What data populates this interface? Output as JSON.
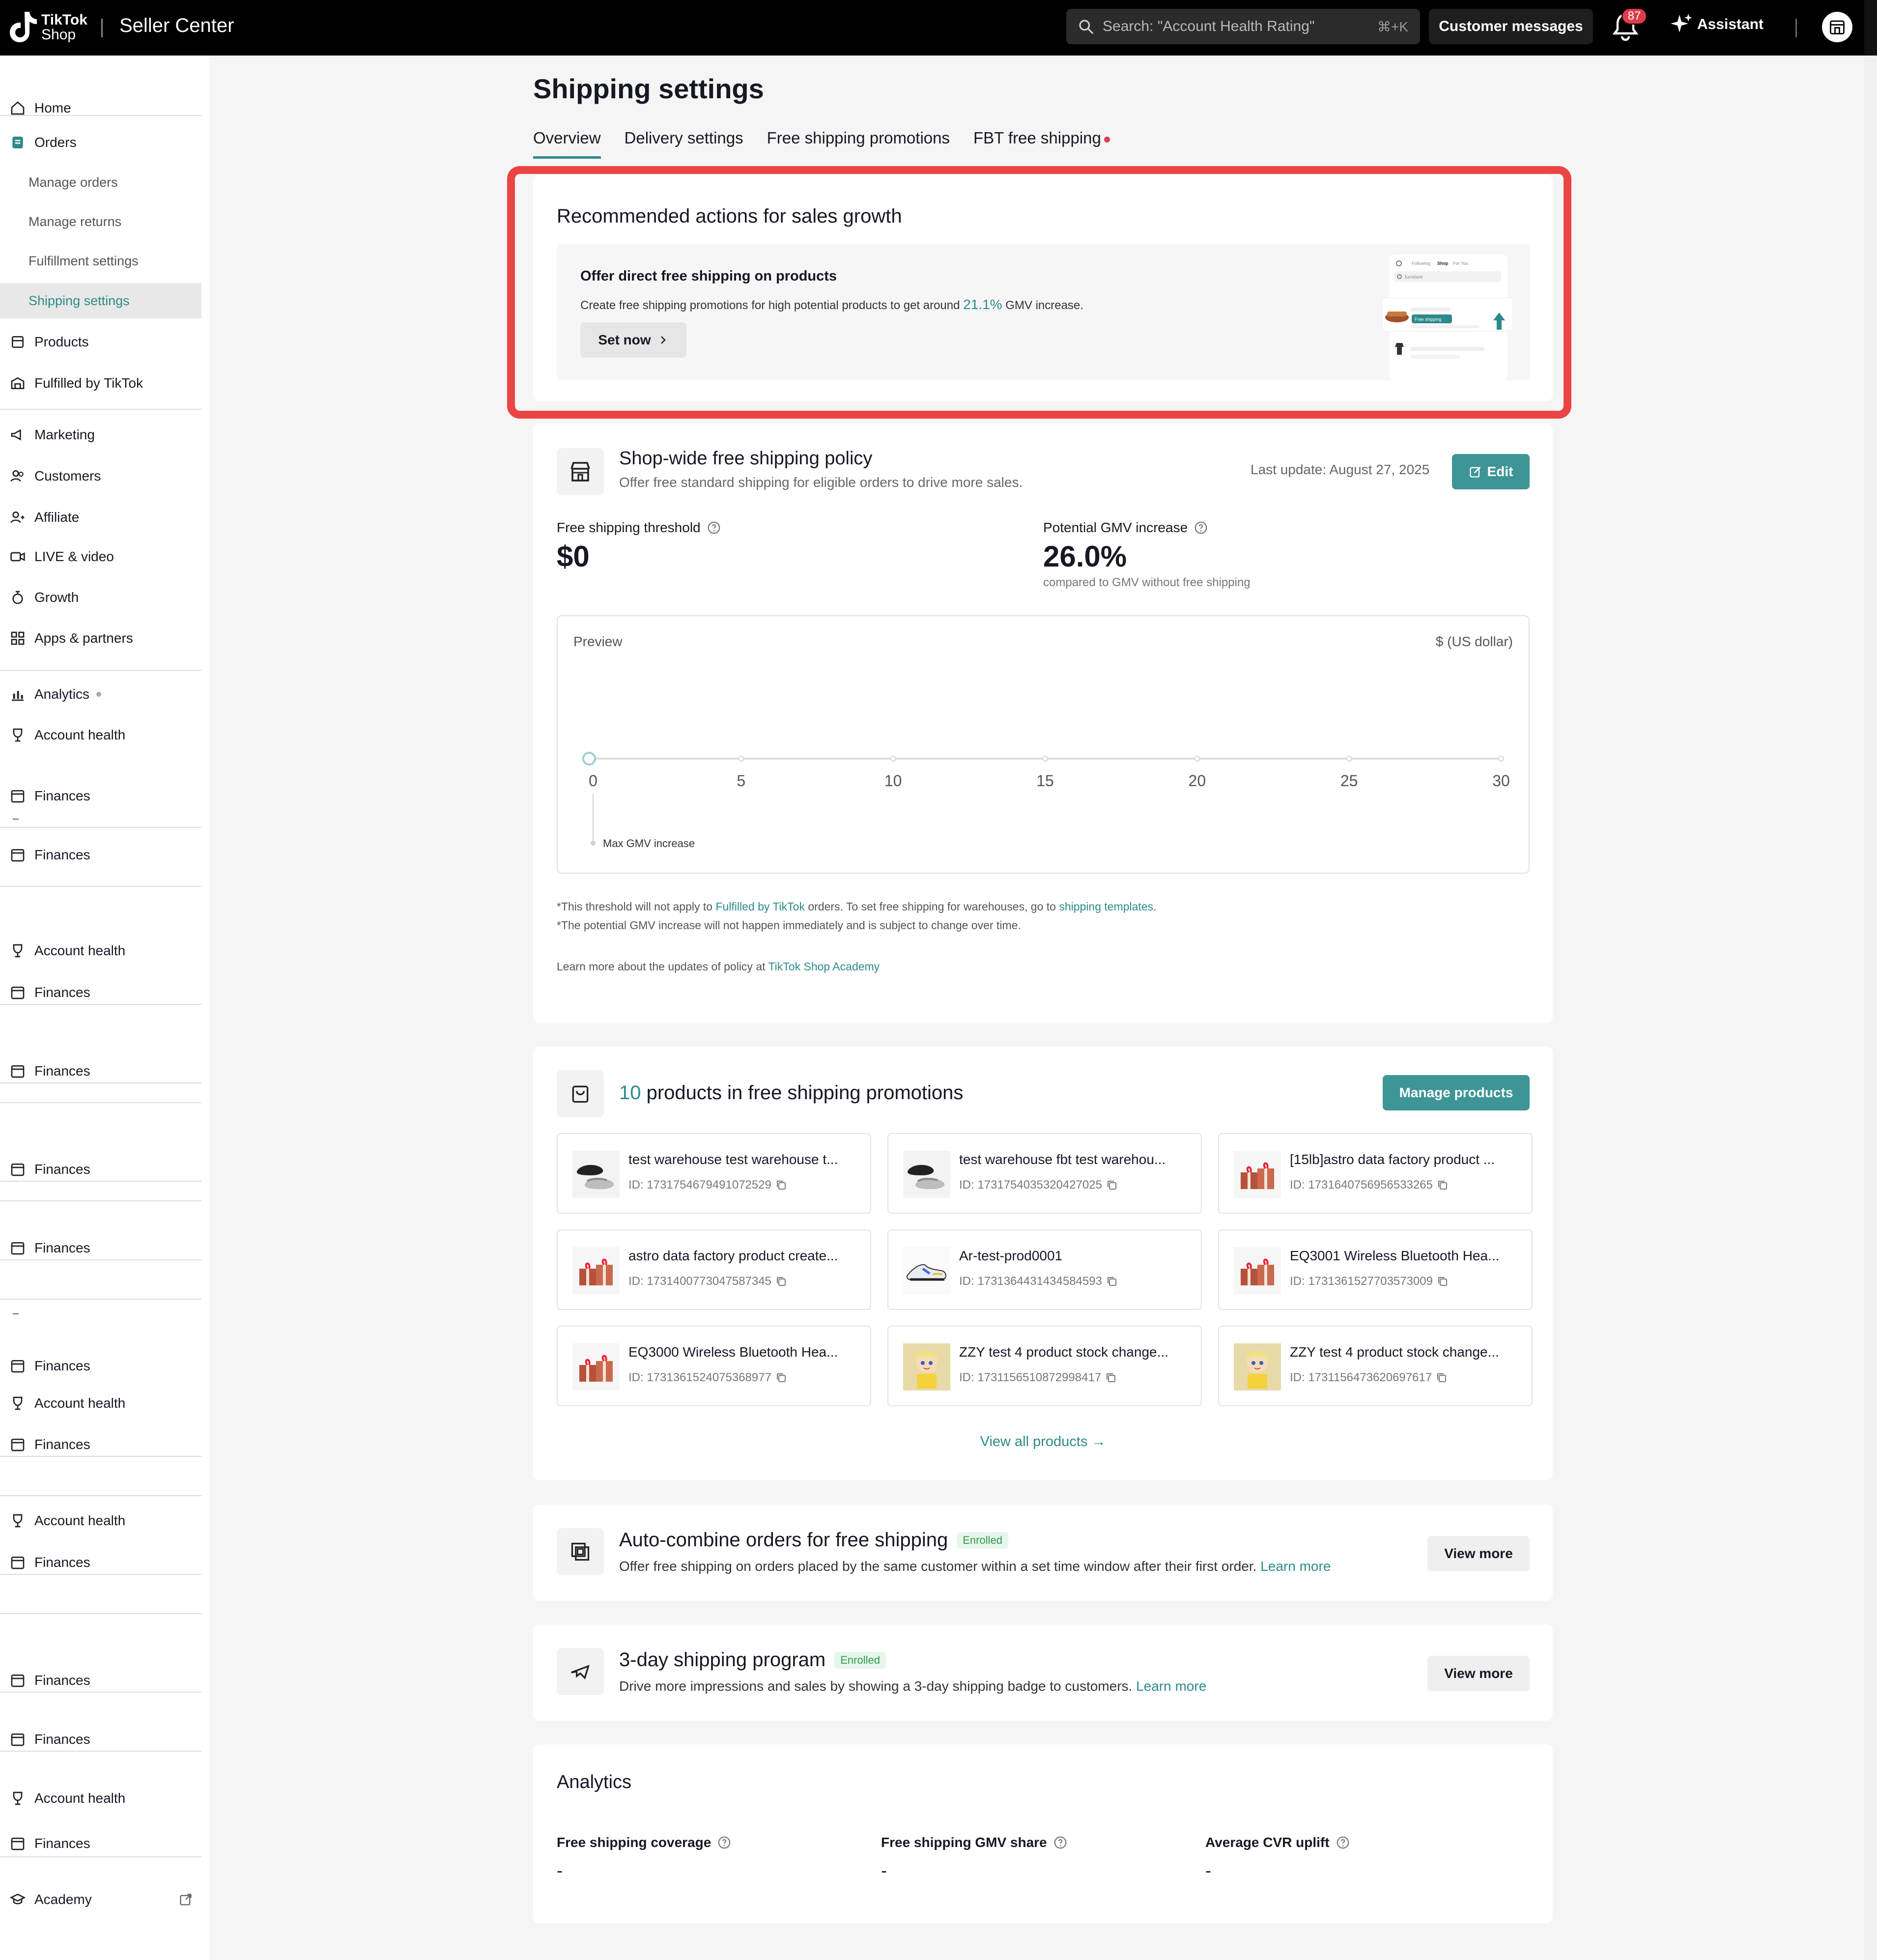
{
  "header": {
    "brand_line1": "TikTok",
    "brand_line2": "Shop",
    "app_name": "Seller Center",
    "search_placeholder": "Search: \"Account Health Rating\"",
    "search_shortcut": "⌘+K",
    "customer_messages": "Customer messages",
    "notification_count": "87",
    "assistant": "Assistant"
  },
  "sidebar": {
    "home": "Home",
    "orders": "Orders",
    "manage_orders": "Manage orders",
    "manage_returns": "Manage returns",
    "fulfillment_settings": "Fulfillment settings",
    "shipping_settings": "Shipping settings",
    "products": "Products",
    "fulfilled_by_tiktok": "Fulfilled by TikTok",
    "marketing": "Marketing",
    "customers": "Customers",
    "affiliate": "Affiliate",
    "live_video": "LIVE & video",
    "growth": "Growth",
    "apps_partners": "Apps & partners",
    "analytics": "Analytics",
    "account_health": "Account health",
    "finances": "Finances",
    "academy": "Academy"
  },
  "page": {
    "title": "Shipping settings",
    "tabs": [
      "Overview",
      "Delivery settings",
      "Free shipping promotions",
      "FBT free shipping"
    ]
  },
  "recommended": {
    "title": "Recommended actions for sales growth",
    "offer_title": "Offer direct free shipping on products",
    "offer_desc_pre": "Create free shipping promotions for high potential products to get around ",
    "offer_desc_value": "21.1%",
    "offer_desc_post": " GMV increase.",
    "set_now": "Set now",
    "illus_tabs": [
      "Following",
      "Shop",
      "For You"
    ],
    "illus_search": "furniture",
    "illus_tag": "Free shipping"
  },
  "shopwide": {
    "title": "Shop-wide free shipping policy",
    "subtitle": "Offer free standard shipping for eligible orders to drive more sales.",
    "last_update": "Last update: August 27, 2025",
    "edit": "Edit",
    "threshold_label": "Free shipping threshold",
    "threshold_value": "$0",
    "gmv_label": "Potential GMV increase",
    "gmv_value": "26.0%",
    "gmv_compare": "compared to GMV without free shipping",
    "preview_label": "Preview",
    "preview_unit": "$ (US dollar)",
    "note1_pre": "*This threshold will not apply to ",
    "note1_link1": "Fulfilled by TikTok",
    "note1_mid": " orders. To set free shipping for warehouses, go to ",
    "note1_link2": "shipping templates",
    "note1_post": ".",
    "note2": "*The potential GMV increase will not happen immediately and is subject to change over time.",
    "note3_pre": "Learn more about the updates of policy at ",
    "note3_link": "TikTok Shop Academy"
  },
  "chart_data": {
    "type": "line",
    "x": [
      0,
      5,
      10,
      15,
      20,
      25,
      30
    ],
    "tick_labels": [
      "0",
      "5",
      "10",
      "15",
      "20",
      "25",
      "30"
    ],
    "xlim": [
      0,
      30
    ],
    "selected_value": 0,
    "annotation": "Max GMV increase",
    "unit": "$ (US dollar)"
  },
  "promo_products": {
    "count": "10",
    "title_rest": " products in free shipping promotions",
    "manage": "Manage products",
    "items": [
      {
        "name": "test warehouse test warehouse t...",
        "id": "ID: 1731754679491072529",
        "thumb": "sandals"
      },
      {
        "name": "test warehouse fbt test warehou...",
        "id": "ID: 1731754035320427025",
        "thumb": "sandals"
      },
      {
        "name": "[15lb]astro data factory product ...",
        "id": "ID: 1731640756956533265",
        "thumb": "gift"
      },
      {
        "name": "astro data factory product create...",
        "id": "ID: 1731400773047587345",
        "thumb": "gift"
      },
      {
        "name": "Ar-test-prod0001",
        "id": "ID: 1731364431434584593",
        "thumb": "sneaker"
      },
      {
        "name": "EQ3001 Wireless Bluetooth Hea...",
        "id": "ID: 1731361527703573009",
        "thumb": "gift"
      },
      {
        "name": "EQ3000 Wireless Bluetooth Hea...",
        "id": "ID: 1731361524075368977",
        "thumb": "gift"
      },
      {
        "name": "ZZY test 4 product stock change...",
        "id": "ID: 1731156510872998417",
        "thumb": "doll"
      },
      {
        "name": "ZZY test 4 product stock change...",
        "id": "ID: 1731156473620697617",
        "thumb": "doll"
      }
    ],
    "view_all": "View all products →"
  },
  "auto_combine": {
    "title": "Auto-combine orders for free shipping",
    "badge": "Enrolled",
    "desc": "Offer free shipping on orders placed by the same customer within a set time window after their first order.",
    "learn_more": "Learn more",
    "view_more": "View more"
  },
  "three_day": {
    "title": "3-day shipping program",
    "badge": "Enrolled",
    "desc": "Drive more impressions and sales by showing a 3-day shipping badge to customers.",
    "learn_more": "Learn more",
    "view_more": "View more"
  },
  "analytics": {
    "title": "Analytics",
    "items": [
      {
        "label": "Free shipping coverage",
        "value": "-"
      },
      {
        "label": "Free shipping GMV share",
        "value": "-"
      },
      {
        "label": "Average CVR uplift",
        "value": "-"
      }
    ]
  },
  "colors": {
    "accent": "#3e9595",
    "link": "#2d8a8a",
    "highlight": "#ea4444",
    "badge_red": "#e13b4b"
  }
}
